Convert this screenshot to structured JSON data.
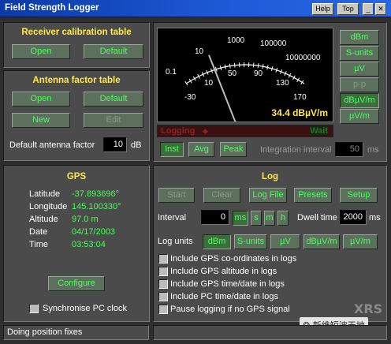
{
  "window": {
    "title": "Field Strength Logger",
    "help": "Help",
    "top": "Top",
    "min": "_",
    "close": "✕"
  },
  "calib": {
    "heading": "Receiver calibration table",
    "open": "Open",
    "default": "Default"
  },
  "antenna": {
    "heading": "Antenna factor table",
    "open": "Open",
    "default": "Default",
    "new": "New",
    "edit": "Edit",
    "factor_label": "Default antenna factor",
    "factor_value": "10",
    "factor_unit": "dB"
  },
  "meter": {
    "reading": "34.4 dBµV/m",
    "logging": "Logging",
    "wait": "Wait",
    "outer_scale": [
      "0.1",
      "10",
      "1000",
      "100000",
      "10000000"
    ],
    "inner_scale": [
      "-30",
      "10",
      "50",
      "90",
      "130",
      "170"
    ],
    "needle_fraction": 0.32
  },
  "units": [
    "dBm",
    "S-units",
    "µV",
    "p-p",
    "dBµV/m",
    "µV/m"
  ],
  "measure": {
    "inst": "Inst",
    "avg": "Avg",
    "peak": "Peak",
    "interval_label": "Integration interval",
    "interval_value": "50",
    "interval_unit": "ms"
  },
  "gps": {
    "heading": "GPS",
    "fields": [
      {
        "k": "Latitude",
        "v": "-37.893696°"
      },
      {
        "k": "Longitude",
        "v": "145.100330°"
      },
      {
        "k": "Altitude",
        "v": "97.0 m"
      },
      {
        "k": "Date",
        "v": "04/17/2003"
      },
      {
        "k": "Time",
        "v": "03:53:04"
      }
    ],
    "configure": "Configure",
    "sync": "Synchronise PC clock"
  },
  "log": {
    "heading": "Log",
    "start": "Start",
    "clear": "Clear",
    "logfile": "Log File",
    "presets": "Presets",
    "setup": "Setup",
    "interval_label": "Interval",
    "interval_value": "0",
    "ms": "ms",
    "s": "s",
    "m": "m",
    "h": "h",
    "dwell_label": "Dwell time",
    "dwell_value": "2000",
    "dwell_unit": "ms",
    "units_label": "Log units",
    "units": [
      "dBm",
      "S-units",
      "µV",
      "dBµV/m",
      "µV/m"
    ],
    "options": [
      "Include GPS co-ordinates in logs",
      "Include GPS altitude in logs",
      "Include GPS time/date in logs",
      "Include PC time/date in logs",
      "Pause logging if no GPS signal"
    ]
  },
  "status": {
    "text": "Doing position fixes"
  },
  "watermark": {
    "brand": "XRS",
    "caption": "新维短波天地"
  },
  "colors": {
    "led_green": "#46ff58",
    "heading_yellow": "#ffe84a",
    "title_blue": "#0b3aa8"
  }
}
